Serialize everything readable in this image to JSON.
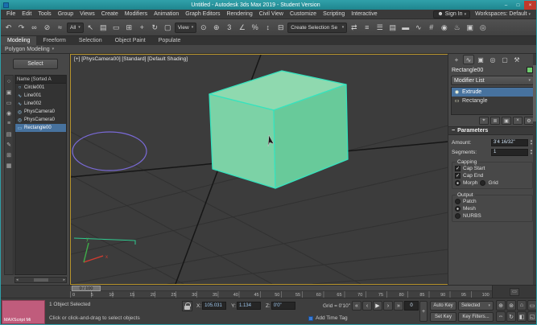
{
  "colors": {
    "titlebar-teal": "#2f9fa8",
    "box-top": "#8fd9af",
    "box-front": "#7cd2a6",
    "box-side": "#68ca9a",
    "box-edge": "#36e3be",
    "circle-stroke": "#7a6ad8",
    "select-blue": "#47729e",
    "maxscript-pink": "#c05c7c",
    "swatch-green": "#6fcf6f",
    "viewport-border": "#b8952e",
    "spline-teal": "#2fc98f"
  },
  "window": {
    "title": "Untitled - Autodesk 3ds Max 2019 - Student Version"
  },
  "icons": {
    "minimize": "–",
    "maximize": "□",
    "close": "×",
    "user": "☻",
    "caret": "▾",
    "plus": "+",
    "time_config": "▭"
  },
  "menubar": {
    "items": [
      "File",
      "Edit",
      "Tools",
      "Group",
      "Views",
      "Create",
      "Modifiers",
      "Animation",
      "Graph Editors",
      "Rendering",
      "Civil View",
      "Customize",
      "Scripting",
      "Interactive"
    ],
    "sign_in": "Sign In",
    "workspaces": "Workspaces: Default"
  },
  "toolbar": {
    "g1": [
      {
        "name": "undo-icon",
        "glyph": "↶"
      },
      {
        "name": "redo-icon",
        "glyph": "↷"
      },
      {
        "name": "select-and-link-icon",
        "glyph": "∞"
      },
      {
        "name": "unlink-selection-icon",
        "glyph": "⊘"
      },
      {
        "name": "bind-to-space-warp-icon",
        "glyph": "≈"
      }
    ],
    "selection_filter": "All",
    "g2": [
      {
        "name": "select-object-icon",
        "glyph": "↖"
      },
      {
        "name": "select-by-name-icon",
        "glyph": "▤"
      },
      {
        "name": "rectangular-selection-icon",
        "glyph": "▭"
      },
      {
        "name": "window-crossing-icon",
        "glyph": "⊞"
      },
      {
        "name": "select-and-move-icon",
        "glyph": "+"
      },
      {
        "name": "select-and-rotate-icon",
        "glyph": "↻"
      },
      {
        "name": "select-and-scale-icon",
        "glyph": "▢"
      }
    ],
    "coord_system": "View",
    "g3": [
      {
        "name": "use-pivot-center-icon",
        "glyph": "⊙"
      },
      {
        "name": "select-and-manipulate-icon",
        "glyph": "⊕"
      },
      {
        "name": "snap-toggle-icon",
        "glyph": "3"
      },
      {
        "name": "angle-snap-icon",
        "glyph": "∠"
      },
      {
        "name": "percent-snap-icon",
        "glyph": "%"
      },
      {
        "name": "spinner-snap-icon",
        "glyph": "↕"
      },
      {
        "name": "named-selection-sets-icon",
        "glyph": "⊟"
      }
    ],
    "selection_set_placeholder": "Create Selection Se",
    "g4": [
      {
        "name": "mirror-icon",
        "glyph": "⇄"
      },
      {
        "name": "align-icon",
        "glyph": "≡"
      },
      {
        "name": "scene-explorer-icon",
        "glyph": "☰"
      },
      {
        "name": "layer-explorer-icon",
        "glyph": "▤"
      },
      {
        "name": "ribbon-toggle-icon",
        "glyph": "▬"
      },
      {
        "name": "curve-editor-icon",
        "glyph": "∿"
      },
      {
        "name": "schematic-view-icon",
        "glyph": "#"
      },
      {
        "name": "material-editor-icon",
        "glyph": "◉"
      },
      {
        "name": "render-setup-icon",
        "glyph": "♨"
      },
      {
        "name": "rendered-frame-icon",
        "glyph": "▣"
      },
      {
        "name": "render-production-icon",
        "glyph": "◎"
      }
    ]
  },
  "ribbon": {
    "tabs": [
      {
        "label": "Modeling",
        "active": true
      },
      {
        "label": "Freeform"
      },
      {
        "label": "Selection"
      },
      {
        "label": "Object Paint"
      },
      {
        "label": "Populate"
      }
    ],
    "section": "Polygon Modeling"
  },
  "scene_panel": {
    "select_label": "Select",
    "header": "Name (Sorted A",
    "tools": [
      {
        "name": "pick-object-icon",
        "glyph": "○"
      },
      {
        "name": "select-all-icon",
        "glyph": "▣"
      },
      {
        "name": "hide-toggle-icon",
        "glyph": "▭"
      },
      {
        "name": "freeze-toggle-icon",
        "glyph": "◉"
      },
      {
        "name": "filter-icon",
        "glyph": "≡"
      },
      {
        "name": "display-mode-icon",
        "glyph": "▤"
      },
      {
        "name": "edit-icon",
        "glyph": "✎"
      },
      {
        "name": "settings-icon",
        "glyph": "⊞"
      },
      {
        "name": "list-view-icon",
        "glyph": "▦"
      }
    ],
    "items": [
      {
        "glyph": "○",
        "label": "Circle001"
      },
      {
        "glyph": "∿",
        "label": "Line001"
      },
      {
        "glyph": "∿",
        "label": "Line002"
      },
      {
        "glyph": "◎",
        "label": "PhysCamera0"
      },
      {
        "glyph": "◎",
        "label": "PhysCamera0"
      },
      {
        "glyph": "▭",
        "label": "Rectangle00",
        "selected": true
      }
    ]
  },
  "viewport": {
    "label": "[+] [PhysCamera00] [Standard] [Default Shading]",
    "axis_x": "x",
    "axis_y": "y"
  },
  "command_panel": {
    "tabs": [
      {
        "name": "create-tab-icon",
        "glyph": "+"
      },
      {
        "name": "modify-tab-icon",
        "glyph": "∿",
        "active": true
      },
      {
        "name": "hierarchy-tab-icon",
        "glyph": "▣"
      },
      {
        "name": "motion-tab-icon",
        "glyph": "◎"
      },
      {
        "name": "display-tab-icon",
        "glyph": "▢"
      },
      {
        "name": "utilities-tab-icon",
        "glyph": "⚒"
      }
    ],
    "object_name": "Rectangle00",
    "modifier_list_label": "Modifier List",
    "stack": [
      {
        "icon": "◉",
        "label": "Extrude",
        "selected": true
      },
      {
        "icon": "▭",
        "label": "Rectangle"
      }
    ],
    "stack_tools": [
      {
        "name": "pin-stack-icon",
        "glyph": "⌖"
      },
      {
        "name": "show-end-result-icon",
        "glyph": "≣"
      },
      {
        "name": "make-unique-icon",
        "glyph": "▣"
      },
      {
        "name": "remove-modifier-icon",
        "glyph": "×"
      },
      {
        "name": "configure-modifier-sets-icon",
        "glyph": "⚙"
      }
    ],
    "rollout_title": "Parameters",
    "collapse_mark": "−",
    "amount_label": "Amount:",
    "amount_value": "3'4 16/32\"",
    "segments_label": "Segments:",
    "segments_value": "1",
    "capping_label": "Capping",
    "cap_start_label": "Cap Start",
    "cap_start_mark": "✓",
    "cap_end_label": "Cap End",
    "cap_end_mark": "✓",
    "morph_label": "Morph",
    "morph_mark": "●",
    "grid_label": "Grid",
    "grid_mark": "",
    "output_label": "Output",
    "patch_label": "Patch",
    "patch_mark": "",
    "mesh_label": "Mesh",
    "mesh_mark": "●",
    "nurbs_label": "NURBS",
    "nurbs_mark": ""
  },
  "timeline": {
    "handle": "0 / 100",
    "ticks": [
      "0",
      "5",
      "10",
      "15",
      "20",
      "25",
      "30",
      "35",
      "40",
      "45",
      "50",
      "55",
      "60",
      "65",
      "70",
      "75",
      "80",
      "85",
      "90",
      "95",
      "100"
    ]
  },
  "statusbar": {
    "maxscript": "MAXScript Mi",
    "selected_text": "1 Object Selected",
    "prompt": "Click or click-and-drag to select objects",
    "x_label": "X:",
    "x_value": "105.031",
    "y_label": "Y:",
    "y_value": "1.134",
    "z_label": "Z:",
    "z_value": "0'0\"",
    "grid_text": "Grid = 0'10\"",
    "add_time_tag": "Add Time Tag",
    "playback": [
      {
        "name": "go-to-start-icon",
        "glyph": "«"
      },
      {
        "name": "previous-frame-icon",
        "glyph": "‹"
      },
      {
        "name": "play-icon",
        "glyph": "▶"
      },
      {
        "name": "next-frame-icon",
        "glyph": "›"
      },
      {
        "name": "go-to-end-icon",
        "glyph": "»"
      }
    ],
    "frame_value": "0",
    "auto_key": "Auto Key",
    "set_key": "Set Key",
    "selected_mode": "Selected",
    "key_filters": "Key Filters...",
    "nav": [
      {
        "name": "zoom-icon",
        "glyph": "⊕"
      },
      {
        "name": "zoom-all-icon",
        "glyph": "⊛"
      },
      {
        "name": "zoom-extents-icon",
        "glyph": "⌂"
      },
      {
        "name": "zoom-region-icon",
        "glyph": "▭"
      },
      {
        "name": "pan-icon",
        "glyph": "⇔"
      },
      {
        "name": "orbit-icon",
        "glyph": "↻"
      },
      {
        "name": "field-of-view-icon",
        "glyph": "◧"
      },
      {
        "name": "maximize-viewport-icon",
        "glyph": "◱"
      }
    ]
  }
}
